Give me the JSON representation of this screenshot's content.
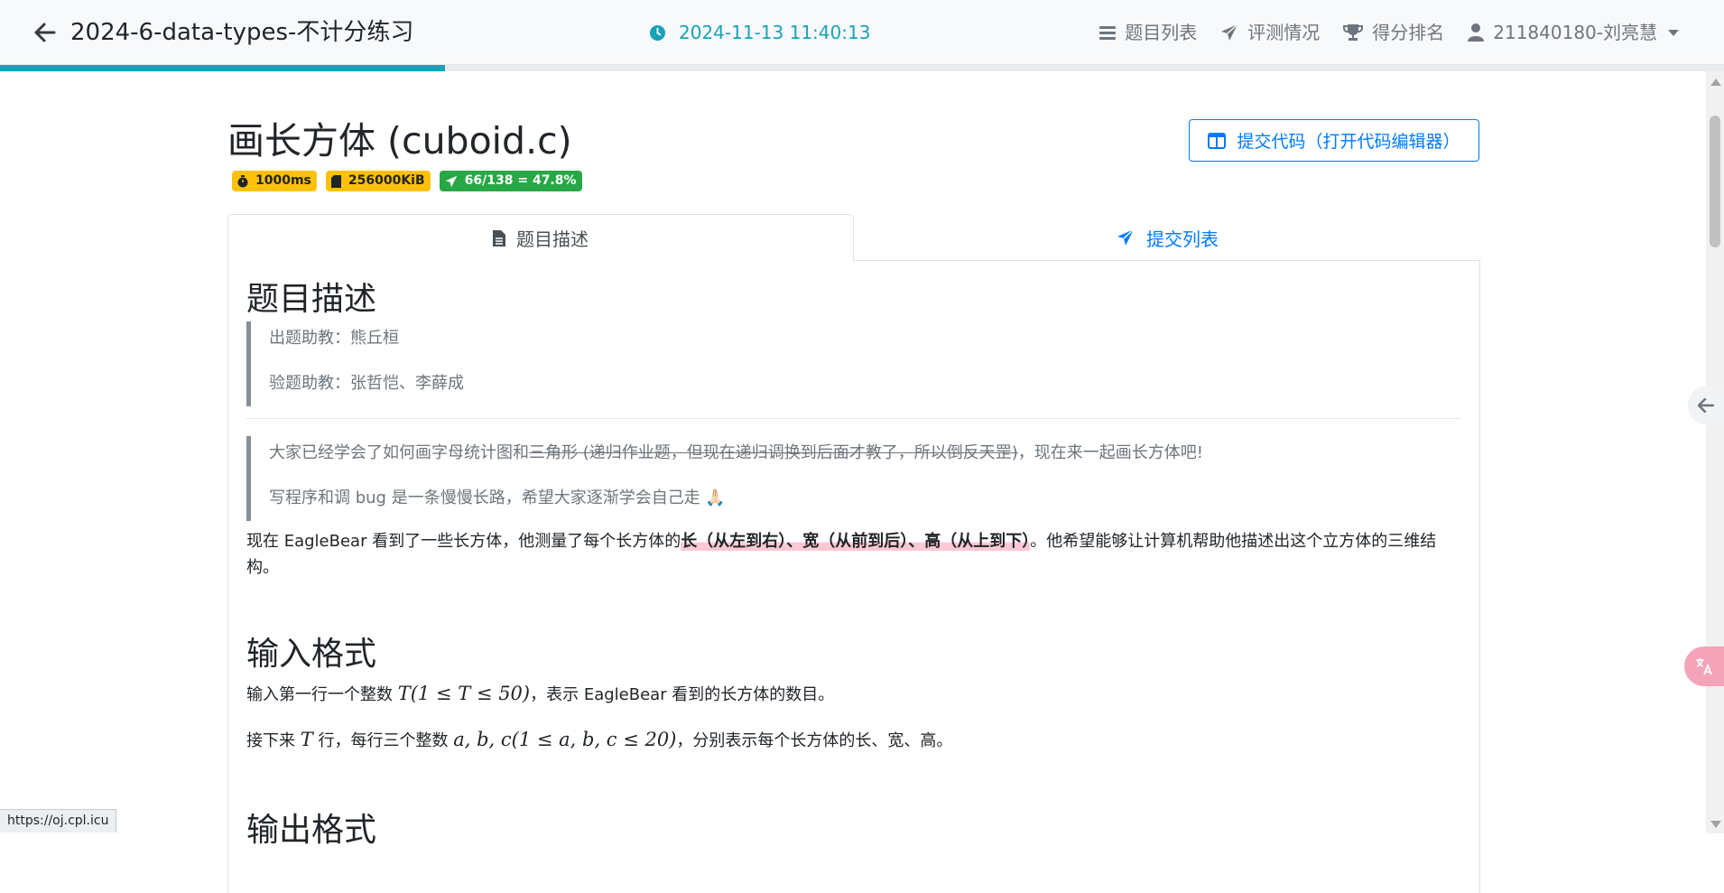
{
  "navbar": {
    "title": "2024-6-data-types-不计分练习",
    "time": "2024-11-13 11:40:13",
    "links": {
      "problem_list": "题目列表",
      "judge_status": "评测情况",
      "rank": "得分排名",
      "user": "211840180-刘亮慧"
    },
    "progress_fraction": 0.258
  },
  "problem": {
    "title": "画长方体 (cuboid.c)",
    "badges": {
      "time_limit": "1000ms",
      "memory_limit": "256000KiB",
      "acceptance": "66/138 = 47.8%"
    },
    "submit_button": "提交代码（打开代码编辑器）"
  },
  "tabs": {
    "description": "题目描述",
    "submissions": "提交列表"
  },
  "content": {
    "desc_heading": "题目描述",
    "setter": "出题助教：熊丘桓",
    "tester": "验题助教：张哲恺、李薛成",
    "note_plain_start": "大家已经学会了如何画字母统计图和",
    "note_strike": "三角形 (递归作业题，但现在递归调换到后面才教了，所以倒反天罡)",
    "note_plain_end": "，现在来一起画长方体吧!",
    "advice": "写程序和调 bug 是一条慢慢长路，希望大家逐渐学会自己走 🙏🏻",
    "story_start": "现在 EagleBear 看到了一些长方体，他测量了每个长方体的",
    "story_highlight": "长（从左到右）、宽（从前到后）、高（从上到下）",
    "story_end": "。他希望能够让计算机帮助他描述出这个立方体的三维结构。",
    "input_heading": "输入格式",
    "input_line1_start": "输入第一行一个整数 ",
    "input_line1_math": "T(1 ≤ T ≤ 50)",
    "input_line1_end": "，表示 EagleBear 看到的长方体的数目。",
    "input_line2_start": "接下来 ",
    "input_line2_math_t": "T",
    "input_line2_mid": " 行，每行三个整数 ",
    "input_line2_math": "a, b, c(1 ≤ a, b, c ≤ 20)",
    "input_line2_end": "，分别表示每个长方体的长、宽、高。",
    "output_heading": "输出格式"
  },
  "status_bar": {
    "url": "https://oj.cpl.icu"
  },
  "colors": {
    "accent": "#17a2b8",
    "primary": "#007bff",
    "warning": "#ffc107",
    "success": "#28a745"
  }
}
